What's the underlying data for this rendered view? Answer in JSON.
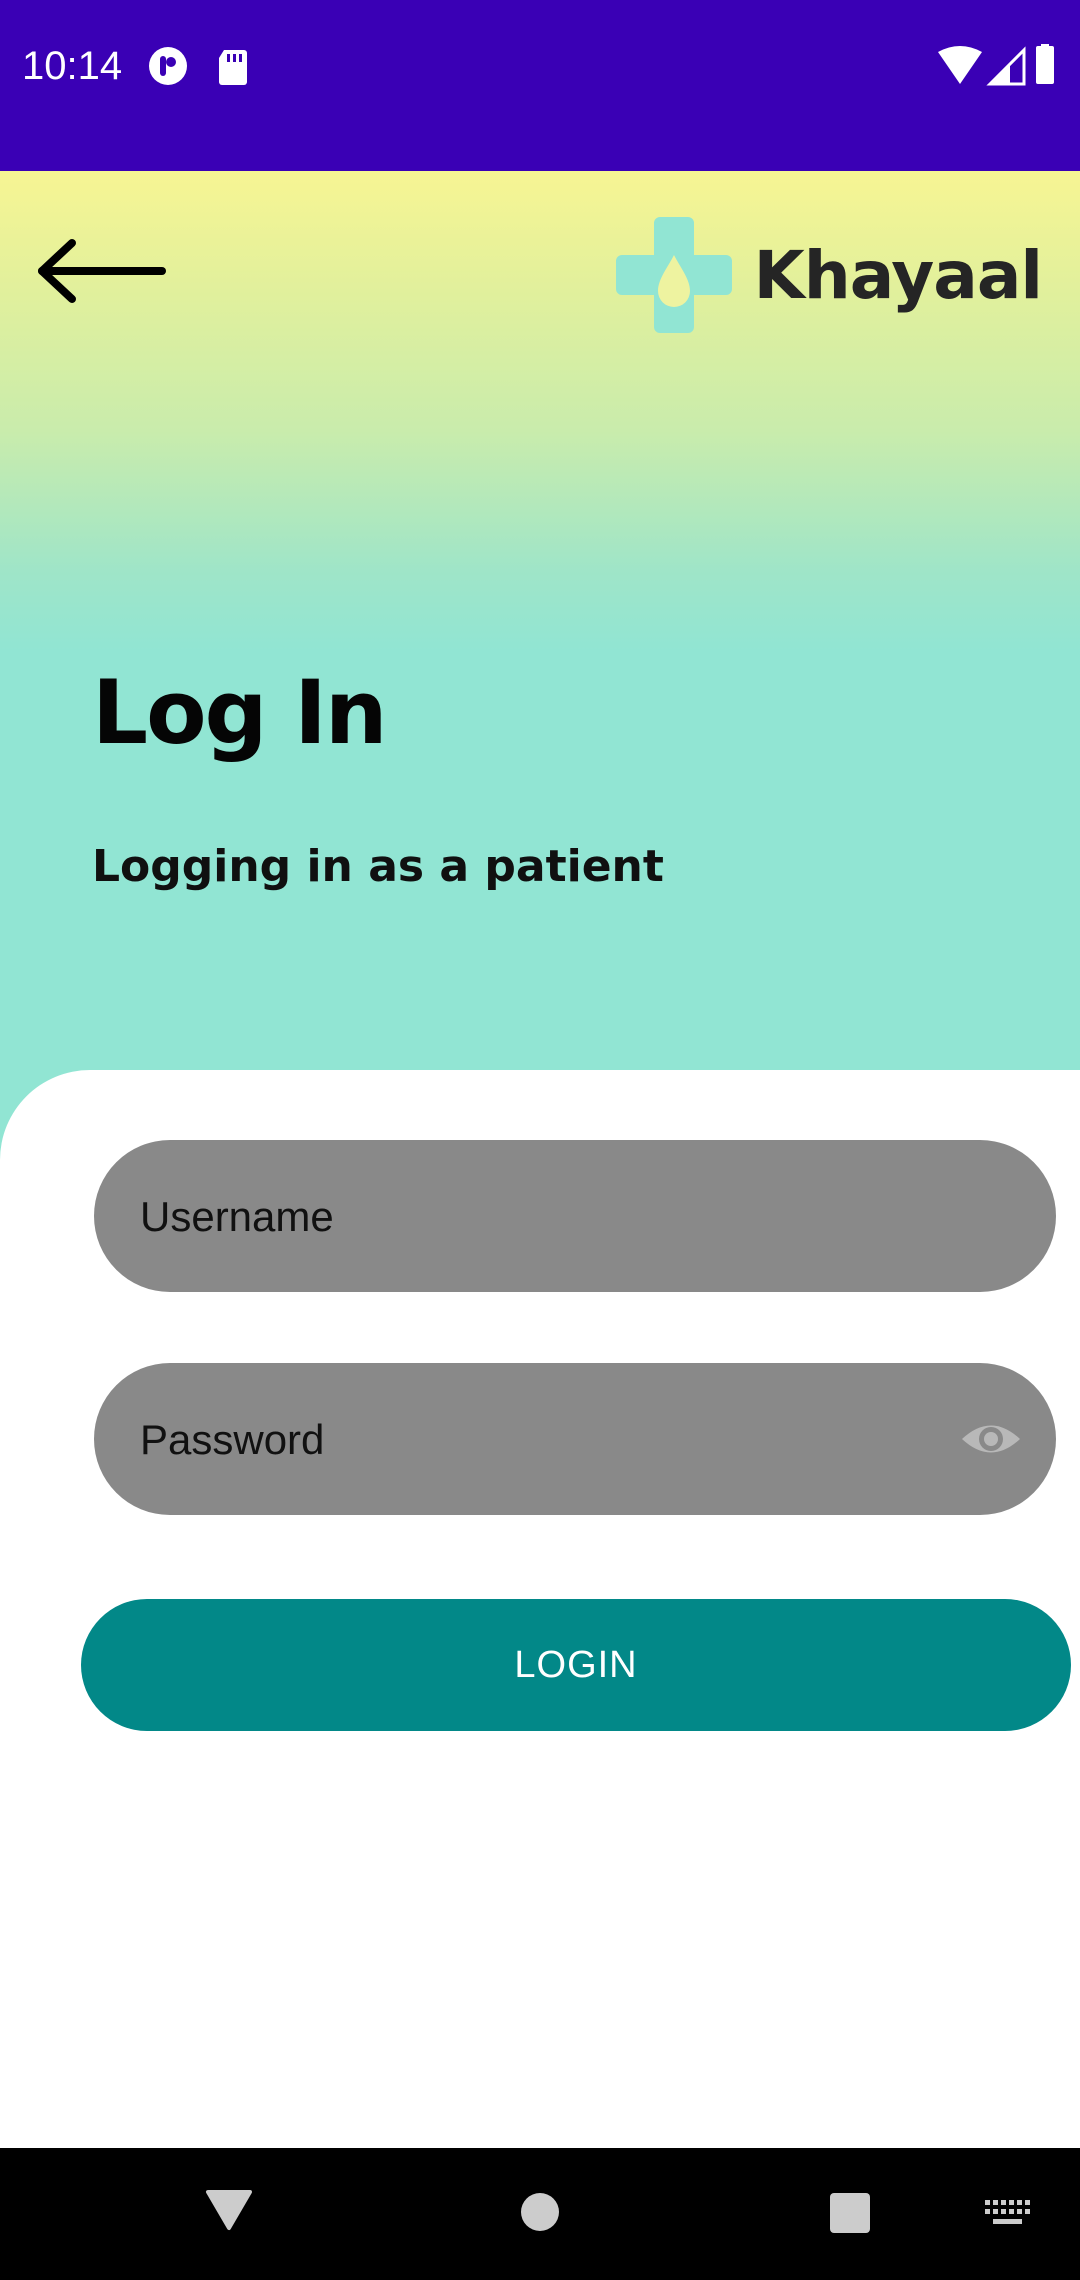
{
  "status_bar": {
    "time": "10:14",
    "left_icons": [
      "app-notification-icon",
      "sd-card-icon"
    ],
    "right_icons": [
      "wifi-icon",
      "cell-signal-icon",
      "battery-icon"
    ],
    "background_color": "#3a00b5"
  },
  "header": {
    "back_icon": "arrow-left-icon",
    "brand_name": "Khayaal",
    "logo_icon": "medical-cross-drop-logo",
    "logo_color": "#91e5d3"
  },
  "hero": {
    "title": "Log In",
    "subtitle": "Logging in as a patient",
    "gradient_top_color": "#f7f593",
    "gradient_bottom_color": "#91e5d3"
  },
  "form": {
    "username_placeholder": "Username",
    "password_placeholder": "Password",
    "password_toggle_icon": "eye-icon",
    "login_label": "LOGIN",
    "field_color": "#898989",
    "button_color": "#028888"
  },
  "nav_bar": {
    "items": [
      "back-triangle-icon",
      "home-circle-icon",
      "recents-square-icon",
      "keyboard-icon"
    ]
  }
}
